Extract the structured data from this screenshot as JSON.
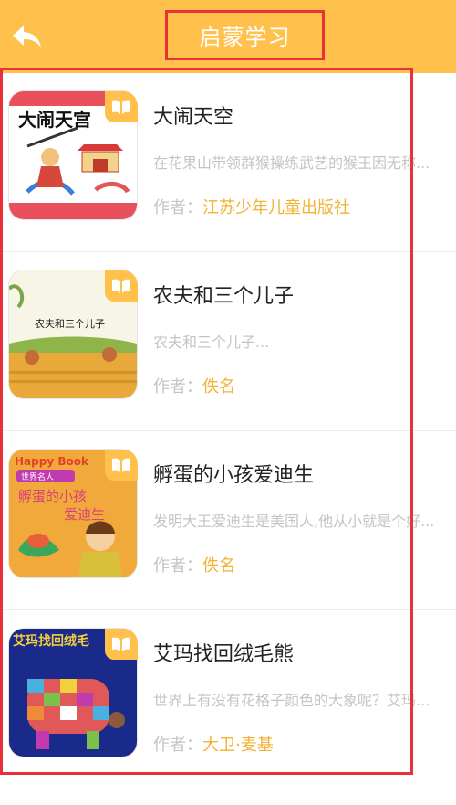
{
  "header": {
    "title": "启蒙学习",
    "back_icon": "back-arrow-icon",
    "background": "#FFC04C"
  },
  "book_icon": "open-book-icon",
  "books": [
    {
      "title": "大闹天空",
      "description": "在花果山带领群猴操练武艺的猴王因无称...",
      "author_label": "作者：",
      "author": "江苏少年儿童出版社",
      "cover_text": "大闹天宫"
    },
    {
      "title": "农夫和三个儿子",
      "description": "农夫和三个儿子...",
      "author_label": "作者：",
      "author": "佚名",
      "cover_text": "农夫和三个儿子"
    },
    {
      "title": "孵蛋的小孩爱迪生",
      "description": "发明大王爱迪生是美国人,他从小就是个好...",
      "author_label": "作者：",
      "author": "佚名",
      "cover_text_top": "Happy Book",
      "cover_text_sub": "世界名人",
      "cover_text_1": "孵蛋的小孩",
      "cover_text_2": "爱迪生"
    },
    {
      "title": "艾玛找回绒毛熊",
      "description": "世界上有没有花格子颜色的大象呢？艾玛...",
      "author_label": "作者：",
      "author": "大卫·麦基",
      "cover_text": "艾玛找回绒毛"
    }
  ],
  "colors": {
    "accent": "#FFC04C",
    "highlight_border": "#E8313A",
    "author_name": "#F2B233",
    "muted": "#c4c4c4"
  }
}
